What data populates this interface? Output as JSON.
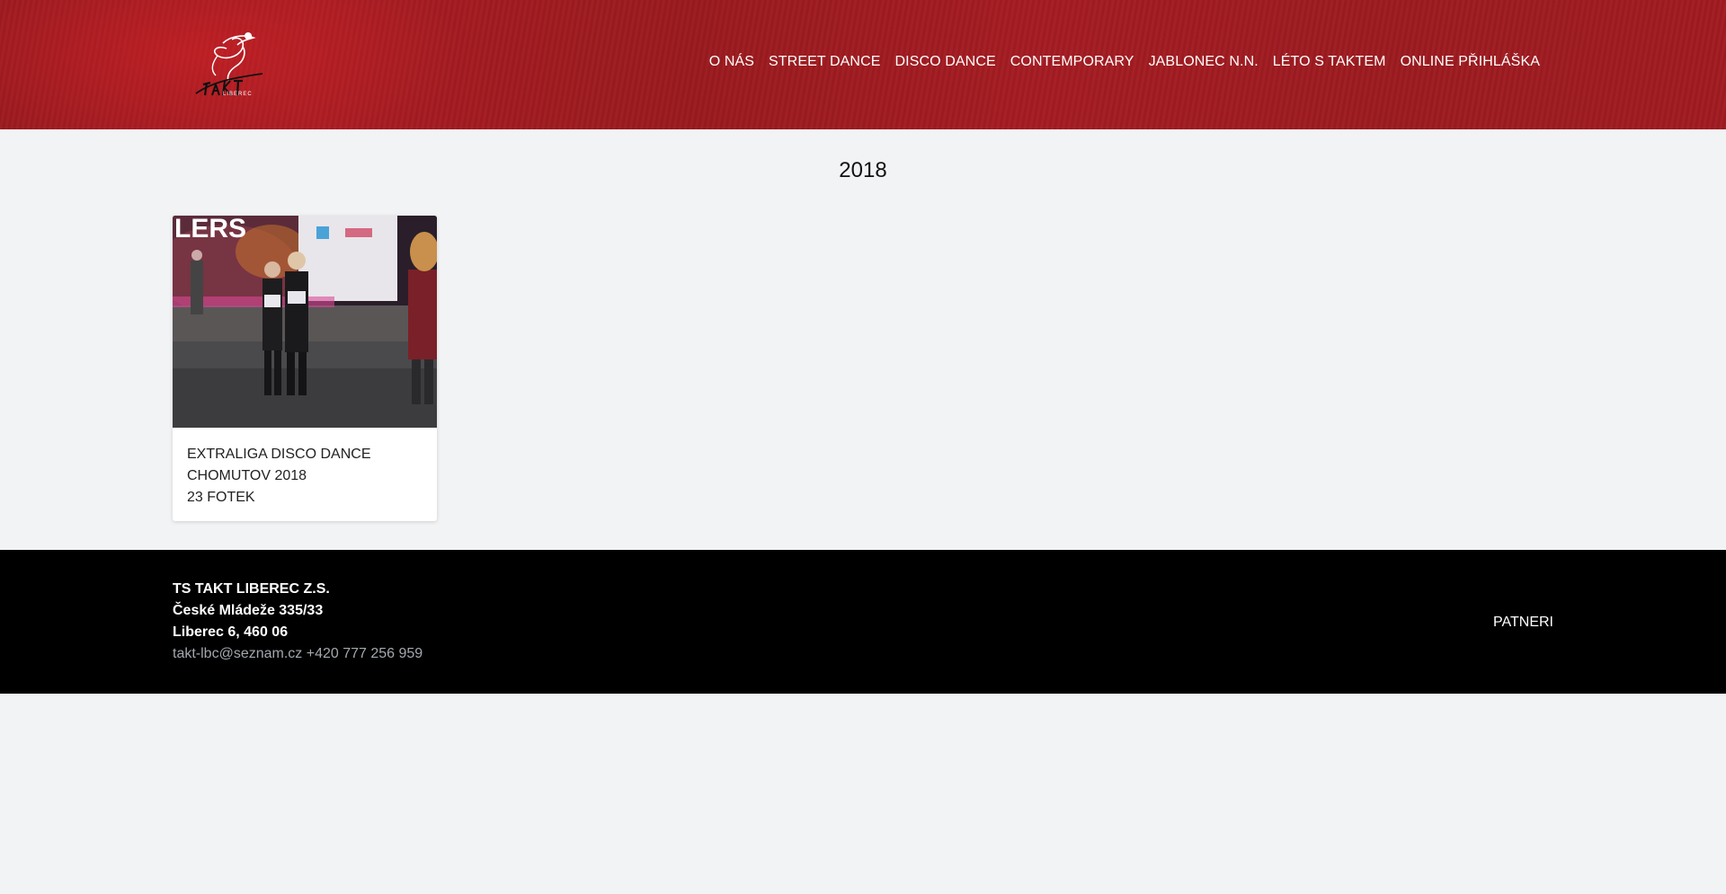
{
  "header": {
    "logo": {
      "icon": "takt-dancer-logo-icon",
      "logo_text": "TAKT LIBEREC"
    },
    "nav": [
      {
        "label": "O NÁS"
      },
      {
        "label": "STREET DANCE"
      },
      {
        "label": "DISCO DANCE"
      },
      {
        "label": "CONTEMPORARY"
      },
      {
        "label": "JABLONEC N.N."
      },
      {
        "label": "LÉTO S TAKTEM"
      },
      {
        "label": "ONLINE PŘIHLÁŠKA"
      }
    ]
  },
  "main": {
    "title": "2018",
    "albums": [
      {
        "title_line1": "EXTRALIGA DISCO DANCE",
        "title_line2": "CHOMUTOV 2018",
        "count": "23 FOTEK",
        "photo_banner_text": "LERS"
      }
    ]
  },
  "footer": {
    "org_name": "TS TAKT LIBEREC Z.S.",
    "street": "České Mládeže 335/33",
    "city": "Liberec 6, 460 06",
    "email": "takt-lbc@seznam.cz",
    "phone": "+420 777 256 959",
    "partners_label": "PATNERI"
  },
  "colors": {
    "header_red": "#a01b21",
    "page_background": "#f2f3f5",
    "footer_background": "#000000",
    "footer_contact": "#a3a8ae"
  }
}
